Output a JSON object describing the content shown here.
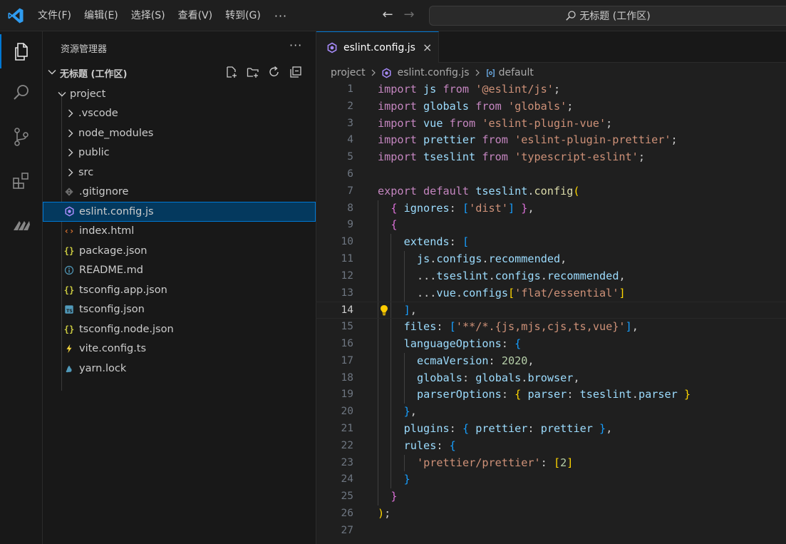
{
  "titlebar": {
    "menu": [
      "文件(F)",
      "编辑(E)",
      "选择(S)",
      "查看(V)",
      "转到(G)"
    ],
    "more": "···",
    "command_center": "无标题 (工作区)"
  },
  "sidebar": {
    "title": "资源管理器",
    "more": "···",
    "workspace": "无标题 (工作区)",
    "tree": [
      {
        "label": "project",
        "kind": "folder-open",
        "depth": 0
      },
      {
        "label": ".vscode",
        "kind": "folder",
        "depth": 1
      },
      {
        "label": "node_modules",
        "kind": "folder",
        "depth": 1
      },
      {
        "label": "public",
        "kind": "folder",
        "depth": 1
      },
      {
        "label": "src",
        "kind": "folder",
        "depth": 1
      },
      {
        "label": ".gitignore",
        "kind": "git-icon",
        "depth": 1
      },
      {
        "label": "eslint.config.js",
        "kind": "eslint-icon",
        "depth": 1,
        "selected": true
      },
      {
        "label": "index.html",
        "kind": "html-icon",
        "depth": 1
      },
      {
        "label": "package.json",
        "kind": "json-icon",
        "depth": 1
      },
      {
        "label": "README.md",
        "kind": "info-icon",
        "depth": 1
      },
      {
        "label": "tsconfig.app.json",
        "kind": "json-icon",
        "depth": 1
      },
      {
        "label": "tsconfig.json",
        "kind": "ts-icon",
        "depth": 1
      },
      {
        "label": "tsconfig.node.json",
        "kind": "json-icon",
        "depth": 1
      },
      {
        "label": "vite.config.ts",
        "kind": "vite-icon",
        "depth": 1
      },
      {
        "label": "yarn.lock",
        "kind": "yarn-icon",
        "depth": 1
      }
    ]
  },
  "editor": {
    "tab_label": "eslint.config.js",
    "tab_close": "×",
    "breadcrumb": [
      "project",
      "eslint.config.js",
      "default"
    ],
    "current_line": 14,
    "lines": [
      "import js from '@eslint/js';",
      "import globals from 'globals';",
      "import vue from 'eslint-plugin-vue';",
      "import prettier from 'eslint-plugin-prettier';",
      "import tseslint from 'typescript-eslint';",
      "",
      "export default tseslint.config(",
      "  { ignores: ['dist'] },",
      "  {",
      "    extends: [",
      "      js.configs.recommended,",
      "      ...tseslint.configs.recommended,",
      "      ...vue.configs['flat/essential']",
      "    ],",
      "    files: ['**/*.{js,mjs,cjs,ts,vue}'],",
      "    languageOptions: {",
      "      ecmaVersion: 2020,",
      "      globals: globals.browser,",
      "      parserOptions: { parser: tseslint.parser }",
      "    },",
      "    plugins: { prettier: prettier },",
      "    rules: {",
      "      'prettier/prettier': [2]",
      "    }",
      "  }",
      ");",
      ""
    ]
  },
  "colors": {
    "accent": "#0078d4",
    "keyword": "#c586c0",
    "identifier": "#9cdcfe",
    "string": "#ce9178",
    "number": "#b5cea8",
    "function": "#dcdcaa"
  }
}
